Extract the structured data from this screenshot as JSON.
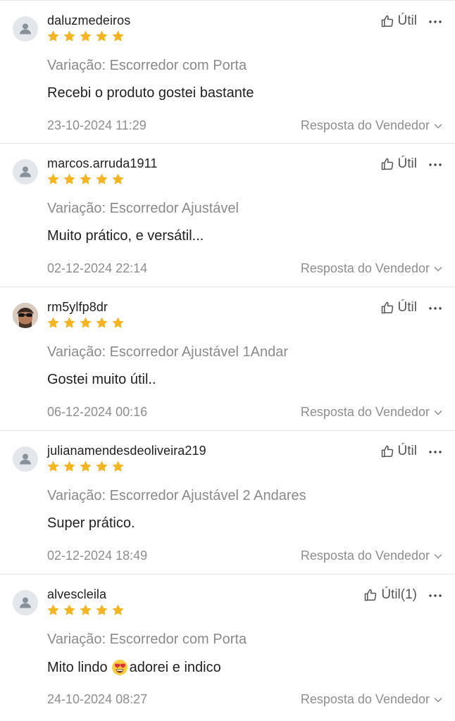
{
  "labels": {
    "helpful": "Útil",
    "seller_reply": "Resposta do Vendedor"
  },
  "colors": {
    "star": "#f6b51e",
    "muted_text": "#8a8a8a",
    "divider": "#e6e6e6"
  },
  "reviews": [
    {
      "username": "daluzmedeiros",
      "rating": 5,
      "avatar": "default-person-icon",
      "variation": "Variação: Escorredor com Porta",
      "comment": "Recebi o produto gostei bastante",
      "timestamp": "23-10-2024 11:29",
      "helpful_label": "Útil"
    },
    {
      "username": "marcos.arruda1911",
      "rating": 5,
      "avatar": "default-person-icon",
      "variation": "Variação: Escorredor Ajustável",
      "comment": "Muito prático, e versátil...",
      "timestamp": "02-12-2024 22:14",
      "helpful_label": "Útil"
    },
    {
      "username": "rm5ylfp8dr",
      "rating": 5,
      "avatar": "profile-photo",
      "variation": "Variação: Escorredor Ajustável 1Andar",
      "comment": "Gostei muito útil..",
      "timestamp": "06-12-2024 00:16",
      "helpful_label": "Útil"
    },
    {
      "username": "julianamendesdeoliveira219",
      "rating": 5,
      "avatar": "default-person-icon",
      "variation": "Variação: Escorredor Ajustável 2 Andares",
      "comment": "Super prático.",
      "timestamp": "02-12-2024 18:49",
      "helpful_label": "Útil"
    },
    {
      "username": "alvescleila",
      "rating": 5,
      "avatar": "default-person-icon",
      "variation": "Variação: Escorredor com Porta",
      "comment_before_emoji": "Mito lindo",
      "comment_emoji": "heart-eyes-emoji",
      "comment_after_emoji": "adorei e indico",
      "timestamp": "24-10-2024 08:27",
      "helpful_label": "Útil(1)"
    }
  ]
}
